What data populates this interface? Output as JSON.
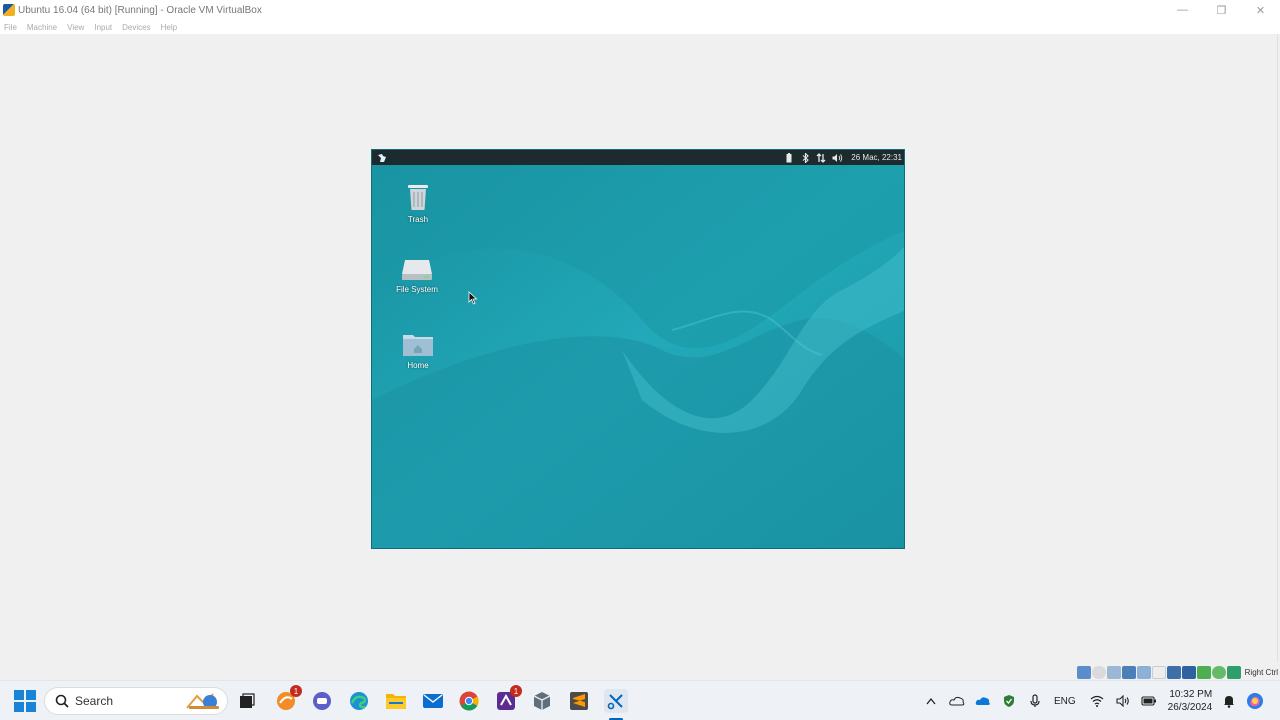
{
  "window": {
    "title": "Ubuntu 16.04 (64 bit) [Running] - Oracle VM VirtualBox",
    "controls": {
      "minimize": "—",
      "restore": "❐",
      "close": "✕"
    }
  },
  "menubar": [
    "File",
    "Machine",
    "View",
    "Input",
    "Devices",
    "Help"
  ],
  "vm": {
    "panel": {
      "clock": "26 Mac, 22:31",
      "tray_icons": [
        "battery-icon",
        "bluetooth-icon",
        "network-icon",
        "volume-icon"
      ]
    },
    "desktop_icons": [
      {
        "label": "Trash",
        "icon": "trash-icon"
      },
      {
        "label": "File System",
        "icon": "drive-icon"
      },
      {
        "label": "Home",
        "icon": "home-folder-icon"
      }
    ],
    "colors": {
      "wallpaper": "#1a9fae",
      "panel": "#1d2b2f"
    }
  },
  "vbox_status": {
    "host_key": "Right Ctrl"
  },
  "taskbar": {
    "search_placeholder": "Search",
    "apps": [
      {
        "name": "task-view",
        "icon": "task-view-icon"
      },
      {
        "name": "app-orange",
        "icon": "orange-app-icon",
        "badge": "1"
      },
      {
        "name": "teams",
        "icon": "chat-icon"
      },
      {
        "name": "edge",
        "icon": "edge-icon"
      },
      {
        "name": "file-explorer",
        "icon": "folder-icon"
      },
      {
        "name": "mail",
        "icon": "mail-icon"
      },
      {
        "name": "chrome",
        "icon": "chrome-icon"
      },
      {
        "name": "visual-studio",
        "icon": "vs-icon",
        "badge": "1"
      },
      {
        "name": "virtualbox",
        "icon": "cube-icon"
      },
      {
        "name": "sublime",
        "icon": "sublime-icon"
      },
      {
        "name": "snipping-tool",
        "icon": "scissors-icon"
      }
    ],
    "tray": {
      "language": "ENG",
      "time": "10:32 PM",
      "date": "26/3/2024"
    }
  }
}
